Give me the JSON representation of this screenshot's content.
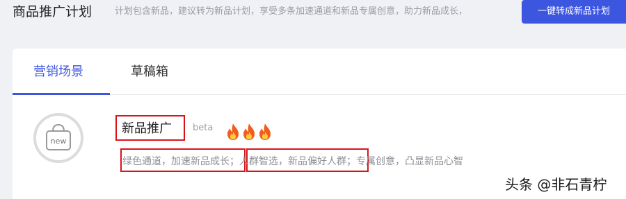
{
  "header": {
    "title": "商品推广计划",
    "description": "计划包含新品，建议转为新品计划，享受多条加速通道和新品专属创意，助力新品成长，",
    "convert_button": "一键转成新品计划"
  },
  "tabs": [
    {
      "label": "营销场景",
      "active": true
    },
    {
      "label": "草稿箱",
      "active": false
    }
  ],
  "scene": {
    "logo_text": "new",
    "title": "新品推广",
    "badge": "beta",
    "hot_level": 3,
    "description": "绿色通道，加速新品成长；人群智选，新品偏好人群；专属创意，凸显新品心智"
  },
  "watermark": "头条 @非石青柠",
  "colors": {
    "accent": "#3d56e0",
    "highlight_border": "#d8141b",
    "fire": "#f25c1c"
  }
}
